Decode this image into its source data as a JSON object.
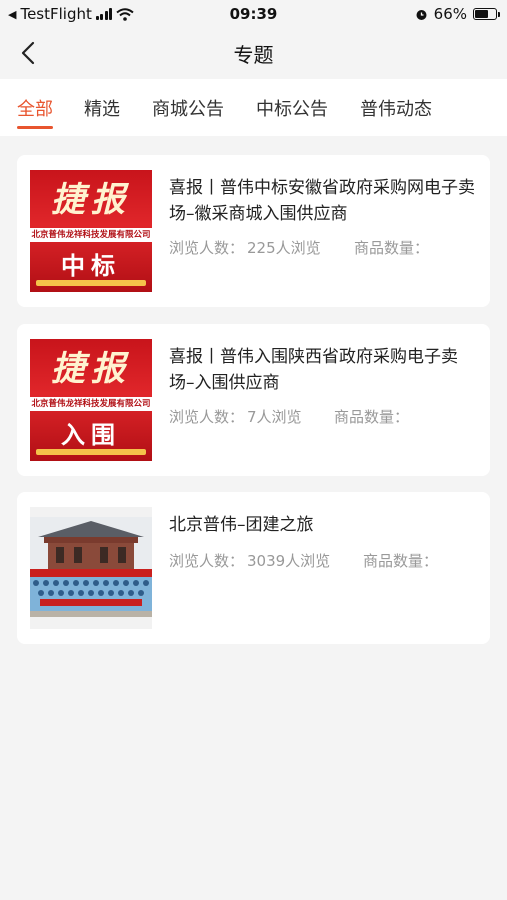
{
  "status": {
    "carrier": "TestFlight",
    "time": "09:39",
    "battery": "66%",
    "battery_level": 0.66
  },
  "nav": {
    "title": "专题"
  },
  "tabs": [
    {
      "label": "全部",
      "active": true
    },
    {
      "label": "精选",
      "active": false
    },
    {
      "label": "商城公告",
      "active": false
    },
    {
      "label": "中标公告",
      "active": false
    },
    {
      "label": "普伟动态",
      "active": false
    }
  ],
  "views_label": "浏览人数：",
  "goods_label": "商品数量：",
  "cards": [
    {
      "title": "喜报丨普伟中标安徽省政府采购网电子卖场–徽采商城入围供应商",
      "views": "225人浏览",
      "poster": {
        "headline": "捷报",
        "company": "北京普伟龙祥科技发展有限公司",
        "result": "中标"
      }
    },
    {
      "title": "喜报丨普伟入围陕西省政府采购电子卖场–入围供应商",
      "views": "7人浏览",
      "poster": {
        "headline": "捷报",
        "company": "北京普伟龙祥科技发展有限公司",
        "result": "入围"
      }
    },
    {
      "title": "北京普伟–团建之旅",
      "views": "3039人浏览"
    }
  ],
  "colors": {
    "accent": "#e8552f",
    "poster_red": "#c8141b"
  }
}
